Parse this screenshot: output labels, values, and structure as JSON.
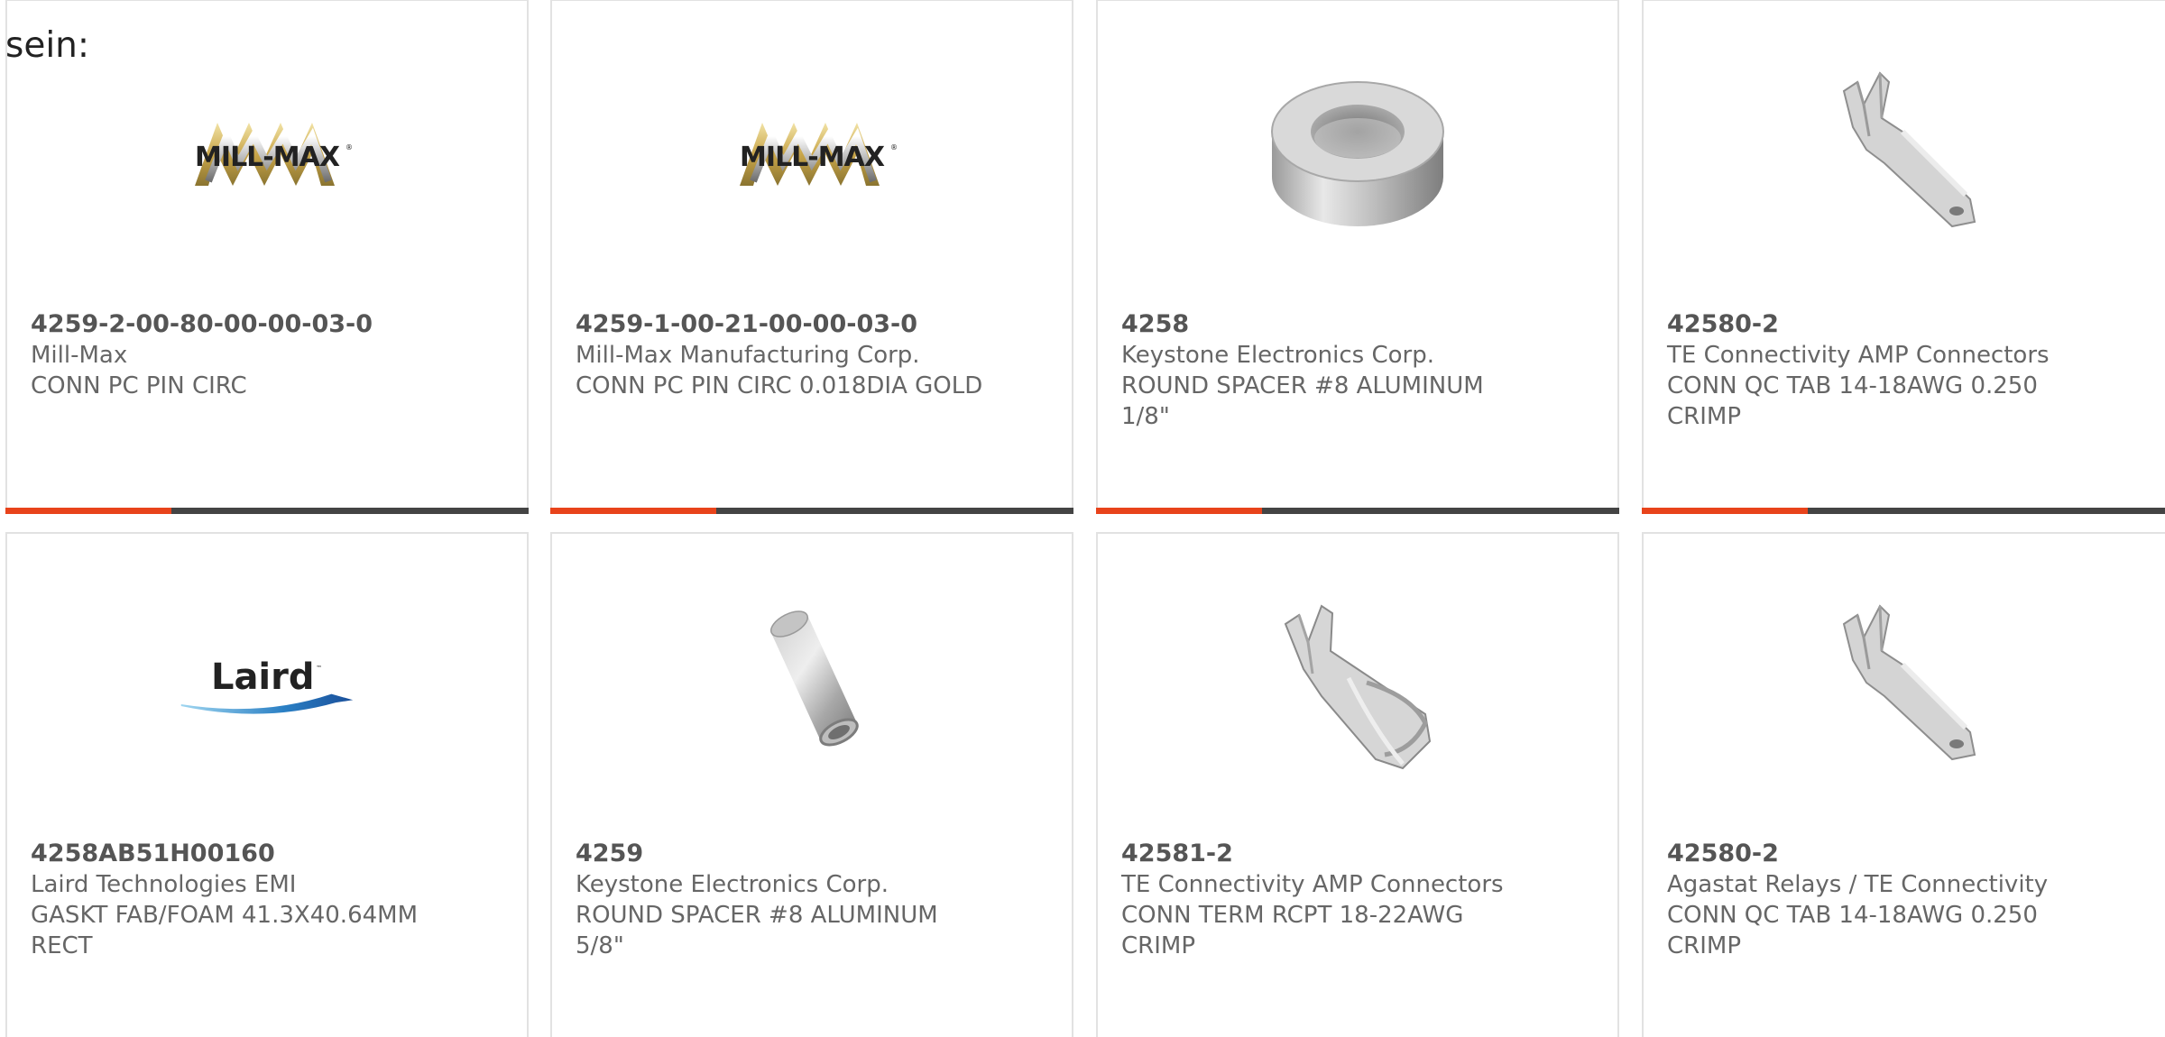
{
  "heading": "sein:",
  "colors": {
    "accent": "#e8431b",
    "bar": "#444444",
    "border": "#e2e2e2",
    "text": "#555555"
  },
  "products": [
    {
      "part_number": "4259-2-00-80-00-00-03-0",
      "manufacturer": "Mill-Max",
      "description": "CONN PC PIN CIRC",
      "image": "mill-max-logo"
    },
    {
      "part_number": "4259-1-00-21-00-00-03-0",
      "manufacturer": "Mill-Max Manufacturing Corp.",
      "description": "CONN PC PIN CIRC 0.018DIA GOLD",
      "image": "mill-max-logo"
    },
    {
      "part_number": "4258",
      "manufacturer": "Keystone Electronics Corp.",
      "description": "ROUND SPACER #8 ALUMINUM 1/8\"",
      "image": "round-spacer-short"
    },
    {
      "part_number": "42580-2",
      "manufacturer": "TE Connectivity AMP Connectors",
      "description": "CONN QC TAB 14-18AWG 0.250 CRIMP",
      "image": "qc-tab-terminal"
    },
    {
      "part_number": "4258AB51H00160",
      "manufacturer": "Laird Technologies EMI",
      "description": "GASKT FAB/FOAM 41.3X40.64MM RECT",
      "image": "laird-logo"
    },
    {
      "part_number": "4259",
      "manufacturer": "Keystone Electronics Corp.",
      "description": "ROUND SPACER #8 ALUMINUM 5/8\"",
      "image": "round-spacer-long"
    },
    {
      "part_number": "42581-2",
      "manufacturer": "TE Connectivity AMP Connectors",
      "description": "CONN TERM RCPT 18-22AWG CRIMP",
      "image": "receptacle-terminal"
    },
    {
      "part_number": "42580-2",
      "manufacturer": "Agastat Relays / TE Connectivity",
      "description": "CONN QC TAB 14-18AWG 0.250 CRIMP",
      "image": "qc-tab-terminal"
    }
  ]
}
